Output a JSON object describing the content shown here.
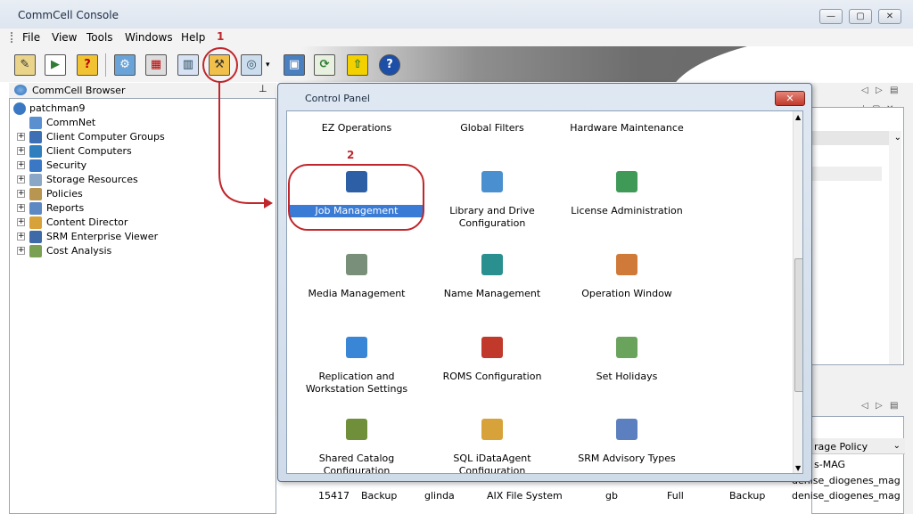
{
  "window": {
    "title": "CommCell Console",
    "minimize_glyph": "—",
    "maximize_glyph": "▢",
    "close_glyph": "✕"
  },
  "menu": [
    "File",
    "View",
    "Tools",
    "Windows",
    "Help"
  ],
  "browser": {
    "title": "CommCell Browser",
    "pin_glyph": "⊥",
    "root": "patchman9",
    "items": [
      {
        "label": "CommNet",
        "icon": "commnet-icon",
        "expandable": false
      },
      {
        "label": "Client Computer Groups",
        "icon": "client-groups-icon",
        "expandable": true
      },
      {
        "label": "Client Computers",
        "icon": "client-computers-icon",
        "expandable": true
      },
      {
        "label": "Security",
        "icon": "security-shield-icon",
        "expandable": true
      },
      {
        "label": "Storage Resources",
        "icon": "storage-icon",
        "expandable": true
      },
      {
        "label": "Policies",
        "icon": "policies-icon",
        "expandable": true
      },
      {
        "label": "Reports",
        "icon": "reports-icon",
        "expandable": true
      },
      {
        "label": "Content Director",
        "icon": "content-director-icon",
        "expandable": true
      },
      {
        "label": "SRM Enterprise Viewer",
        "icon": "srm-viewer-icon",
        "expandable": true
      },
      {
        "label": "Cost Analysis",
        "icon": "cost-analysis-icon",
        "expandable": true
      }
    ]
  },
  "dialog": {
    "title": "Control Panel",
    "close_glyph": "✕",
    "items": [
      {
        "label": "EZ Operations",
        "icon": "ez-operations-icon"
      },
      {
        "label": "Global Filters",
        "icon": "global-filters-icon"
      },
      {
        "label": "Hardware Maintenance",
        "icon": "hardware-maintenance-icon"
      },
      {
        "label": "Job Management",
        "icon": "job-management-icon",
        "selected": true
      },
      {
        "label": "Library and Drive Configuration",
        "icon": "library-drive-icon"
      },
      {
        "label": "License Administration",
        "icon": "license-admin-icon"
      },
      {
        "label": "Media Management",
        "icon": "media-management-icon"
      },
      {
        "label": "Name Management",
        "icon": "name-management-icon"
      },
      {
        "label": "Operation Window",
        "icon": "operation-window-icon"
      },
      {
        "label": "Replication and Workstation Settings",
        "icon": "replication-icon"
      },
      {
        "label": "ROMS Configuration",
        "icon": "roms-config-icon"
      },
      {
        "label": "Set Holidays",
        "icon": "set-holidays-icon"
      },
      {
        "label": "Shared Catalog Configuration",
        "icon": "shared-catalog-icon"
      },
      {
        "label": "SQL iDataAgent Configuration",
        "icon": "sql-idataagent-icon"
      },
      {
        "label": "SRM Advisory Types",
        "icon": "srm-advisory-icon"
      }
    ]
  },
  "annotations": {
    "step1": "1",
    "step2": "2"
  },
  "background_panel": {
    "column_header": "rage Policy",
    "row1_partial": "s-MAG",
    "row2": [
      "15417",
      "Backup",
      "glinda",
      "AIX File System",
      "gb",
      "Full",
      "Backup",
      "denise_diogenes_mag"
    ],
    "row1_right": "denise_diogenes_mag"
  },
  "colors": {
    "accent_red": "#c0262b",
    "selection_blue": "#3a7bd5"
  }
}
